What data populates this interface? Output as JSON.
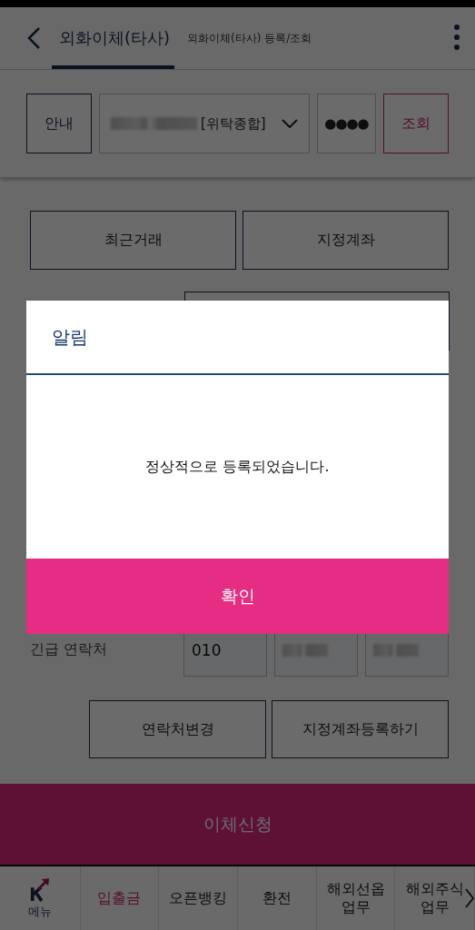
{
  "header": {
    "tabs": [
      {
        "label": "외화이체(타사)",
        "selected": true
      },
      {
        "label": "외화이체(타사) 등록/조회",
        "selected": false
      }
    ]
  },
  "account_bar": {
    "guide_button": "안내",
    "account": {
      "redacted": true,
      "type": "[위탁종합]"
    },
    "password": "●●●●",
    "query_button": "조회"
  },
  "quick_buttons": [
    "최근거래",
    "지정계좌"
  ],
  "contact": {
    "label": "긴급 연락처",
    "fields": [
      {
        "value": "010",
        "redacted": false
      },
      {
        "redacted": true
      },
      {
        "redacted": true
      }
    ]
  },
  "action_buttons": [
    "연락처변경",
    "지정계좌등록하기"
  ],
  "submit_button": "이체신청",
  "bottom_nav": [
    {
      "kind": "logo",
      "label": "메뉴",
      "selected": false
    },
    {
      "kind": "tab",
      "label": "입출금",
      "selected": true
    },
    {
      "kind": "tab",
      "label": "오픈뱅킹",
      "selected": false
    },
    {
      "kind": "tab",
      "label": "환전",
      "selected": false
    },
    {
      "kind": "tab",
      "label": "해외선옵\n업무",
      "selected": false
    },
    {
      "kind": "tab",
      "label": "해외주식\n업무",
      "selected": false
    }
  ],
  "dialog": {
    "title": "알림",
    "message": "정상적으로 등록되었습니다.",
    "confirm_button": "확인"
  }
}
